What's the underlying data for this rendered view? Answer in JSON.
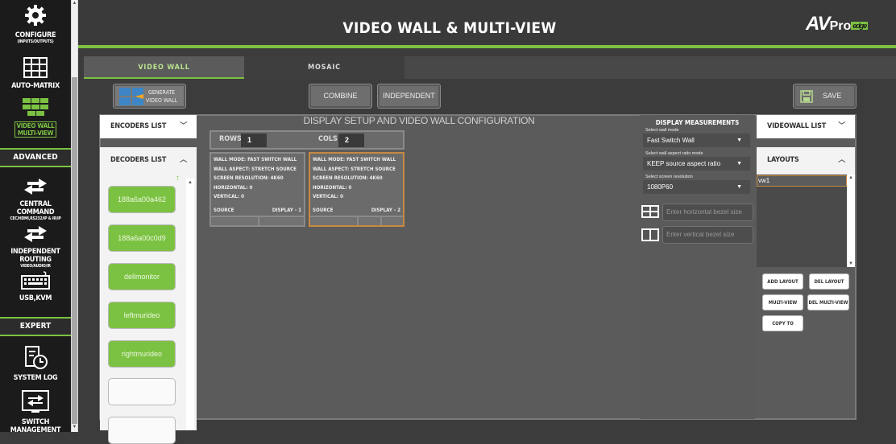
{
  "sidebar": {
    "items": [
      {
        "label": "CONFIGURE",
        "sub": "(INPUTS/OUTPUTS)",
        "icon": "gear-icon"
      },
      {
        "label": "AUTO-MATRIX",
        "icon": "matrix-grid-icon"
      },
      {
        "label": "VIDEO WALL\nMULTI-VIEW",
        "icon": "video-wall-icon",
        "active": true
      },
      {
        "label": "CENTRAL COMMAND",
        "sub": "CEC/HDMI,RS232/IP & IR/IP",
        "icon": "arrows-exchange-icon"
      },
      {
        "label": "INDEPENDENT ROUTING",
        "sub": "VIDEO/AUDIO/IR",
        "icon": "arrows-exchange-icon"
      },
      {
        "label": "USB,KVM",
        "icon": "keyboard-icon"
      },
      {
        "label": "SYSTEM LOG",
        "icon": "log-clock-icon"
      },
      {
        "label": "SWITCH MANAGEMENT",
        "icon": "switch-icon"
      }
    ],
    "sections": {
      "advanced": "ADVANCED",
      "expert": "EXPERT"
    }
  },
  "header": {
    "title": "VIDEO WALL & MULTI-VIEW",
    "logo_av": "AV",
    "logo_pro": "Pro",
    "logo_edge": "edge"
  },
  "tabs": {
    "video_wall": "VIDEO WALL",
    "mosaic": "MOSAIC"
  },
  "toolbar": {
    "generate": "GENERATE\nVIDEO WALL",
    "combine": "COMBINE",
    "independent": "INDEPENDENT",
    "save": "SAVE"
  },
  "encoders": {
    "label": "ENCODERS LIST"
  },
  "decoders": {
    "label": "DECODERS LIST",
    "items": [
      "188a6a00a462",
      "188a6a00c0d9",
      "dellmonitor",
      "leftmurideo",
      "rightmurideo",
      "",
      ""
    ]
  },
  "config": {
    "title": "DISPLAY SETUP AND VIDEO WALL CONFIGURATION",
    "rows_label": "ROWS",
    "rows": "1",
    "cols_label": "COLS",
    "cols": "2"
  },
  "displays": [
    {
      "mode": "WALL MODE: FAST SWITCH WALL",
      "aspect": "WALL ASPECT: STRETCH SOURCE",
      "res": "SCREEN RESOLUTION: 4K60",
      "horiz": "HORIZONTAL: 0",
      "vert": "VERTICAL: 0",
      "source": "SOURCE",
      "name": "DISPLAY - 1"
    },
    {
      "mode": "WALL MODE: FAST SWITCH WALL",
      "aspect": "WALL ASPECT: STRETCH SOURCE",
      "res": "SCREEN RESOLUTION: 4K60",
      "horiz": "HORIZONTAL: 0",
      "vert": "VERTICAL: 0",
      "source": "SOURCE",
      "name": "DISPLAY - 2"
    }
  ],
  "measurements": {
    "title": "DISPLAY MEASUREMENTS",
    "wall_mode_label": "Select wall mode",
    "wall_mode": "Fast Switch Wall",
    "aspect_label": "Select wall aspect ratio mode",
    "aspect": "KEEP source aspect ratio",
    "res_label": "Select screen resolution",
    "res": "1080P60",
    "hbezel_placeholder": "Enter horizontal bezel size",
    "vbezel_placeholder": "Enter vertical bezel size"
  },
  "videowall_list": {
    "label": "VIDEOWALL LIST"
  },
  "layouts": {
    "label": "LAYOUTS",
    "items": [
      "vw1"
    ],
    "add": "ADD LAYOUT",
    "del": "DEL LAYOUT",
    "multiview": "MULTI-VIEW",
    "del_multiview": "DEL MULTI-VIEW",
    "copy": "COPY TO"
  },
  "colors": {
    "accent": "#7cc242",
    "selected_border": "#c58a42"
  }
}
